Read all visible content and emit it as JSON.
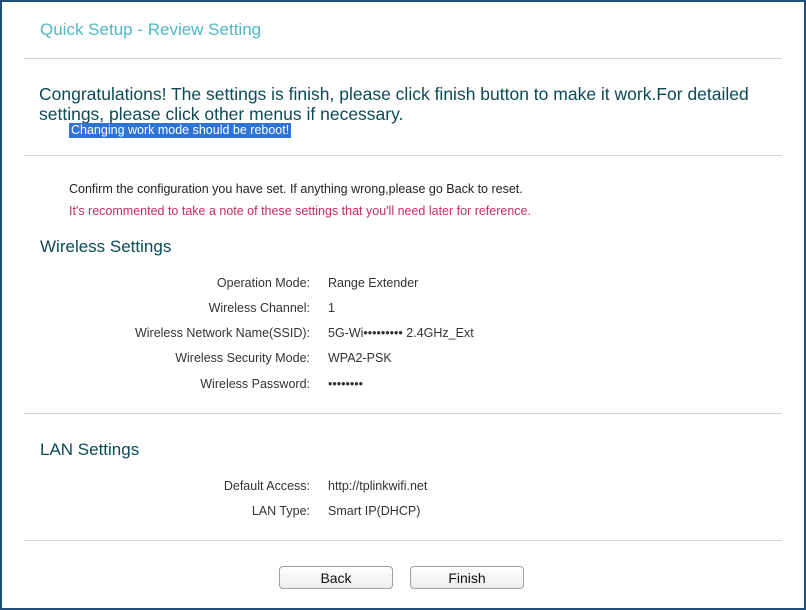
{
  "page": {
    "title": "Quick Setup - Review Setting",
    "congrats": "Congratulations! The settings is finish, please click finish button to make it work.For detailed settings, please click other menus if necessary.",
    "reboot_notice": "Changing work mode should be reboot!",
    "confirm_text": "Confirm the configuration you have set. If anything wrong,please go Back to reset.",
    "note_text": "It's recommented to take a note of these settings that you'll need later for reference."
  },
  "wireless": {
    "heading": "Wireless Settings",
    "rows": [
      {
        "label": "Operation Mode:",
        "value": "Range Extender"
      },
      {
        "label": "Wireless Channel:",
        "value": "1"
      },
      {
        "label": "Wireless Network Name(SSID):",
        "value": "5G-Wi•••••••••  2.4GHz_Ext"
      },
      {
        "label": "Wireless Security Mode:",
        "value": "WPA2-PSK"
      },
      {
        "label": "Wireless Password:",
        "value": "••••••••"
      }
    ]
  },
  "lan": {
    "heading": "LAN Settings",
    "rows": [
      {
        "label": "Default Access:",
        "value": "http://tplinkwifi.net"
      },
      {
        "label": "LAN Type:",
        "value": "Smart IP(DHCP)"
      }
    ]
  },
  "buttons": {
    "back": "Back",
    "finish": "Finish"
  },
  "colors": {
    "title": "#4fb8c4",
    "heading": "#0b4a57",
    "note": "#c0305f",
    "highlight": "#2e73d6",
    "frame": "#1f4e79"
  }
}
